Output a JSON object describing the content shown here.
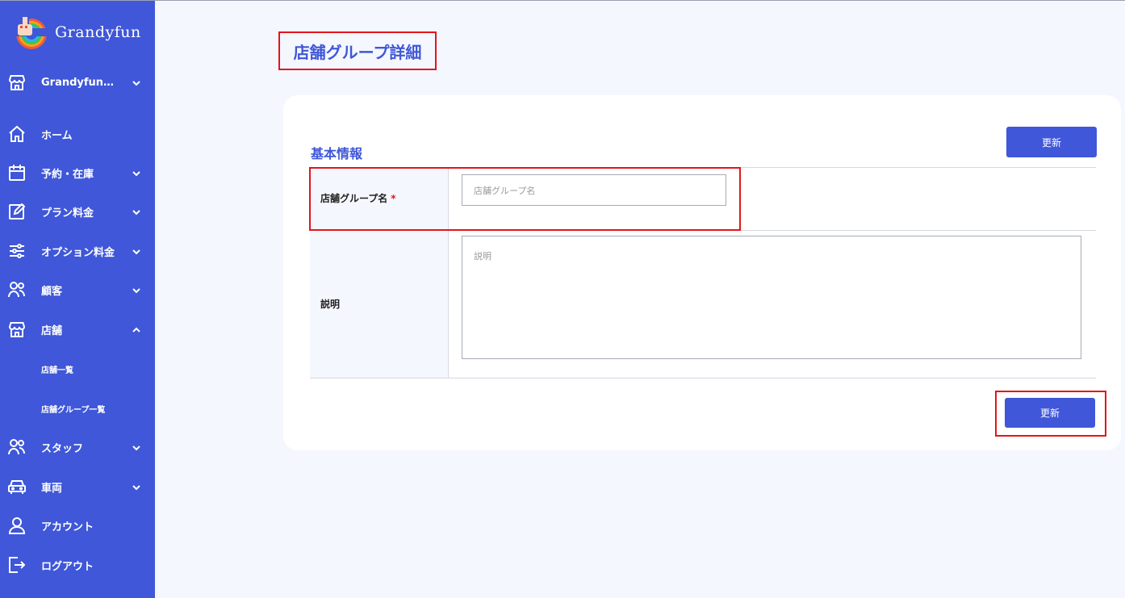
{
  "brand": {
    "name": "Grandyfun"
  },
  "sidebar": {
    "items": [
      {
        "label": "Grandyfun…",
        "icon": "store-icon",
        "chevron": "chevron-down-icon"
      },
      {
        "label": "ホーム",
        "icon": "home-icon"
      },
      {
        "label": "予約・在庫",
        "icon": "calendar-icon",
        "chevron": "chevron-down-icon"
      },
      {
        "label": "プラン料金",
        "icon": "edit-icon",
        "chevron": "chevron-down-icon"
      },
      {
        "label": "オプション料金",
        "icon": "sliders-icon",
        "chevron": "chevron-down-icon"
      },
      {
        "label": "顧客",
        "icon": "users-icon",
        "chevron": "chevron-down-icon"
      },
      {
        "label": "店舗",
        "icon": "store-icon",
        "chevron": "chevron-up-icon"
      },
      {
        "label": "スタッフ",
        "icon": "users-icon",
        "chevron": "chevron-down-icon"
      },
      {
        "label": "車両",
        "icon": "car-icon",
        "chevron": "chevron-down-icon"
      },
      {
        "label": "アカウント",
        "icon": "user-icon"
      },
      {
        "label": "ログアウト",
        "icon": "logout-icon"
      }
    ],
    "sub_items": [
      {
        "label": "店舗一覧"
      },
      {
        "label": "店舗グループ一覧"
      }
    ]
  },
  "main": {
    "page_title": "店舗グループ詳細",
    "section_title": "基本情報",
    "update_button_top": "更新",
    "update_button_bottom": "更新",
    "form": {
      "group_name": {
        "label": "店舗グループ名",
        "required_mark": "*",
        "placeholder": "店舗グループ名",
        "value": ""
      },
      "description": {
        "label": "説明",
        "placeholder": "説明",
        "value": ""
      }
    }
  },
  "colors": {
    "accent": "#3f57d8",
    "highlight": "#e3151a",
    "background": "#f5f7fe"
  }
}
